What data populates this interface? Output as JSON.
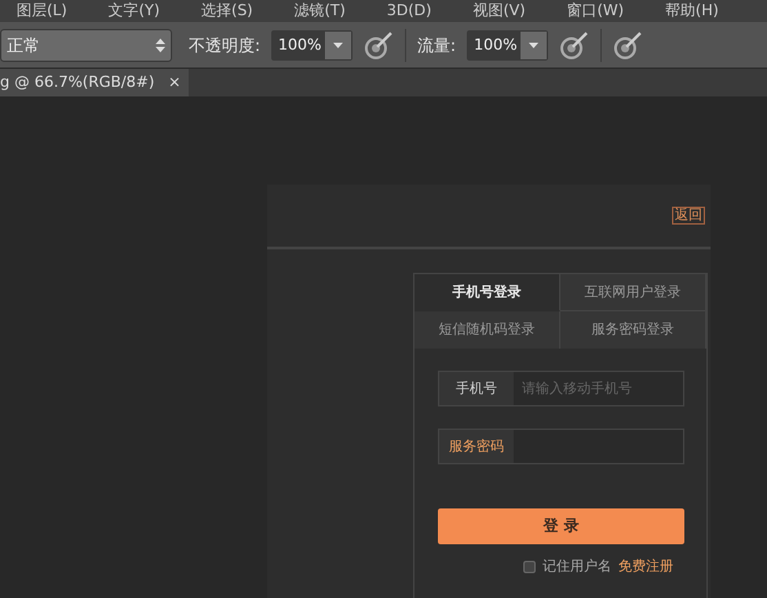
{
  "menu": [
    {
      "label": "图层(L)"
    },
    {
      "label": "文字(Y)"
    },
    {
      "label": "选择(S)"
    },
    {
      "label": "滤镜(T)"
    },
    {
      "label": "3D(D)"
    },
    {
      "label": "视图(V)"
    },
    {
      "label": "窗口(W)"
    },
    {
      "label": "帮助(H)"
    }
  ],
  "options_bar": {
    "blend_mode": "正常",
    "opacity_label": "不透明度:",
    "opacity_value": "100%",
    "flow_label": "流量:",
    "flow_value": "100%"
  },
  "document_tab": {
    "title": "g @ 66.7%(RGB/8#)",
    "close": "×"
  },
  "login_mock": {
    "back_link": "返回",
    "tabs": [
      {
        "label": "手机号登录",
        "selected": true
      },
      {
        "label": "互联网用户登录",
        "selected": false
      },
      {
        "label": "短信随机码登录",
        "selected": false
      },
      {
        "label": "服务密码登录",
        "selected": false
      }
    ],
    "fields": [
      {
        "label": "手机号",
        "placeholder": "请输入移动手机号",
        "highlighted": false
      },
      {
        "label": "服务密码",
        "highlighted": true
      }
    ],
    "submit": "登 录",
    "remember": {
      "label": "记住用户名",
      "checked": false
    },
    "register_link": "免费注册"
  }
}
